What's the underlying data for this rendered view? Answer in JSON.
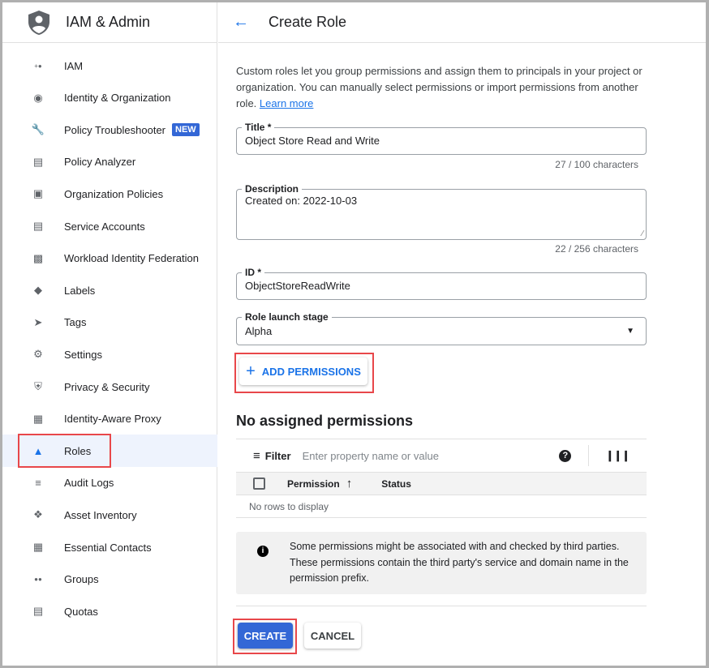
{
  "sidebar": {
    "title": "IAM & Admin",
    "items": [
      {
        "label": "IAM",
        "icon": "person-add-icon"
      },
      {
        "label": "Identity & Organization",
        "icon": "account-circle-icon"
      },
      {
        "label": "Policy Troubleshooter",
        "icon": "wrench-icon",
        "badge": "NEW"
      },
      {
        "label": "Policy Analyzer",
        "icon": "document-search-icon"
      },
      {
        "label": "Organization Policies",
        "icon": "policy-document-icon"
      },
      {
        "label": "Service Accounts",
        "icon": "service-account-icon"
      },
      {
        "label": "Workload Identity Federation",
        "icon": "id-card-icon"
      },
      {
        "label": "Labels",
        "icon": "label-icon"
      },
      {
        "label": "Tags",
        "icon": "tag-icon"
      },
      {
        "label": "Settings",
        "icon": "gear-icon"
      },
      {
        "label": "Privacy & Security",
        "icon": "shield-icon"
      },
      {
        "label": "Identity-Aware Proxy",
        "icon": "proxy-icon"
      },
      {
        "label": "Roles",
        "icon": "roles-hat-icon",
        "active": true
      },
      {
        "label": "Audit Logs",
        "icon": "list-icon"
      },
      {
        "label": "Asset Inventory",
        "icon": "diamond-icon"
      },
      {
        "label": "Essential Contacts",
        "icon": "contact-card-icon"
      },
      {
        "label": "Groups",
        "icon": "groups-icon"
      },
      {
        "label": "Quotas",
        "icon": "quota-icon"
      }
    ]
  },
  "header": {
    "title": "Create Role"
  },
  "intro": {
    "text": "Custom roles let you group permissions and assign them to principals in your project or organization. You can manually select permissions or import permissions from another role.",
    "link": "Learn more"
  },
  "form": {
    "title": {
      "label": "Title *",
      "value": "Object Store Read and Write",
      "count": "27 / 100 characters"
    },
    "description": {
      "label": "Description",
      "value": "Created on: 2022-10-03",
      "count": "22 / 256 characters"
    },
    "id": {
      "label": "ID *",
      "value": "ObjectStoreReadWrite"
    },
    "stage": {
      "label": "Role launch stage",
      "value": "Alpha"
    }
  },
  "add_permissions": "ADD PERMISSIONS",
  "permissions": {
    "heading": "No assigned permissions",
    "filter_label": "Filter",
    "filter_placeholder": "Enter property name or value",
    "columns": [
      "Permission",
      "Status"
    ],
    "empty": "No rows to display"
  },
  "notice": "Some permissions might be associated with and checked by third parties. These permissions contain the third party's service and domain name in the permission prefix.",
  "actions": {
    "create": "CREATE",
    "cancel": "CANCEL"
  },
  "colors": {
    "accent": "#1a73e8",
    "primary_button": "#3367d6",
    "highlight": "#e8474a"
  }
}
